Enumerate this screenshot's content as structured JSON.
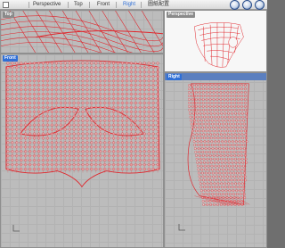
{
  "tabs": {
    "items": [
      {
        "label": "Perspective"
      },
      {
        "label": "Top"
      },
      {
        "label": "Front"
      },
      {
        "label": "Right",
        "active": true
      },
      {
        "label": "圖紙配置"
      }
    ]
  },
  "viewports": {
    "top": {
      "label": "Top"
    },
    "perspective": {
      "label": "Perspective"
    },
    "front": {
      "label": "Front"
    },
    "right": {
      "label": "Right"
    }
  },
  "colors": {
    "geometry": "#e0262c",
    "active_tab": "#2f6fd6",
    "viewport_bg": "#bcbcbc"
  }
}
